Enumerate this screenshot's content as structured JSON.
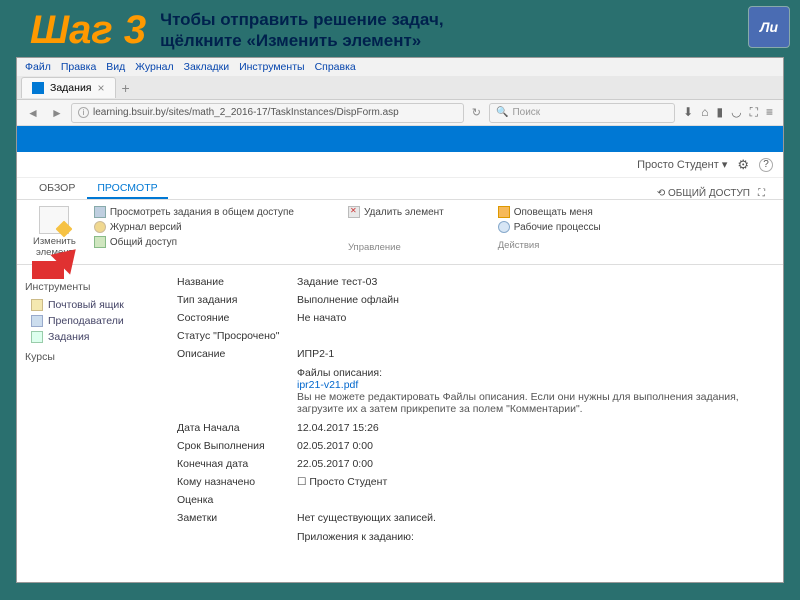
{
  "slide": {
    "step": "Шаг 3",
    "subtitle_line1": "Чтобы отправить решение задач,",
    "subtitle_line2": "щёлкните «Изменить элемент»",
    "logo_text": "Ли"
  },
  "browser": {
    "menu": [
      "Файл",
      "Правка",
      "Вид",
      "Журнал",
      "Закладки",
      "Инструменты",
      "Справка"
    ],
    "tab_title": "Задания",
    "url": "learning.bsuir.by/sites/math_2_2016-17/TaskInstances/DispForm.asp",
    "search_placeholder": "Поиск",
    "toolbar_icons": [
      "download",
      "home",
      "bookmark",
      "pocket",
      "fullscreen",
      "menu"
    ]
  },
  "sharepoint": {
    "user": "Просто Студент",
    "ribbon_tabs": {
      "overview": "ОБЗОР",
      "view": "ПРОСМОТР"
    },
    "share_btn": "ОБЩИЙ ДОСТУП",
    "edit_btn_line1": "Изменить",
    "edit_btn_line2": "элемент",
    "manage_group": {
      "view_public": "Просмотреть задания в общем доступе",
      "history": "Журнал версий",
      "share": "Общий доступ",
      "delete": "Удалить элемент",
      "label": "Управление"
    },
    "actions_group": {
      "alert": "Оповещать меня",
      "workflow": "Рабочие процессы",
      "label": "Действия"
    }
  },
  "leftnav": {
    "section1": "Инструменты",
    "mailbox": "Почтовый ящик",
    "teachers": "Преподаватели",
    "tasks": "Задания",
    "section2": "Курсы"
  },
  "task": {
    "labels": {
      "name": "Название",
      "type": "Тип задания",
      "state": "Состояние",
      "status": "Статус \"Просрочено\"",
      "desc": "Описание",
      "files_hdr": "Файлы описания:",
      "files_note": "Вы не можете редактировать Файлы описания. Если они нужны для выполнения задания, загрузите их а затем прикрепите за полем \"Комментарии\".",
      "start": "Дата Начала",
      "due": "Срок Выполнения",
      "end": "Конечная дата",
      "assigned": "Кому назначено",
      "grade": "Оценка",
      "notes": "Заметки",
      "attach": "Приложения к заданию:"
    },
    "values": {
      "name": "Задание тест-03",
      "type": "Выполнение офлайн",
      "state": "Не начато",
      "desc": "ИПР2-1",
      "file_link": "ipr21-v21.pdf",
      "start": "12.04.2017 15:26",
      "due": "02.05.2017 0:00",
      "end": "22.05.2017 0:00",
      "assigned": "Просто Студент",
      "notes": "Нет существующих записей."
    }
  }
}
